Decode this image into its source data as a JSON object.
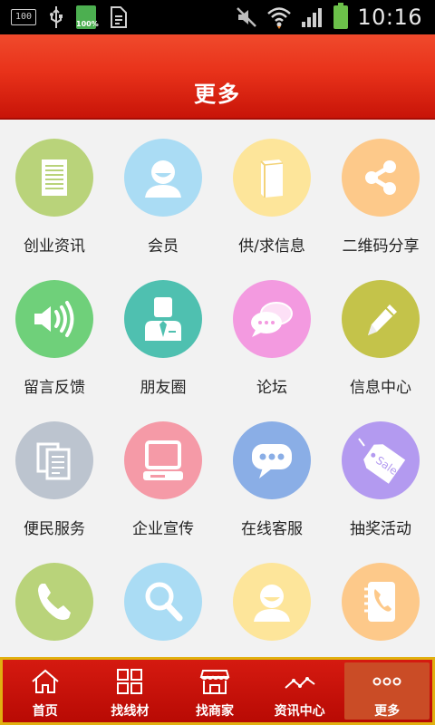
{
  "status_bar": {
    "left_box_text": "100",
    "battery_small_text": "100%",
    "time": "10:16",
    "icons": [
      "storage-icon",
      "usb-icon",
      "battery-full-icon",
      "sim-card-icon",
      "mute-icon",
      "wifi-icon",
      "signal-icon",
      "battery-icon"
    ]
  },
  "header": {
    "title": "更多"
  },
  "grid": {
    "items": [
      {
        "label": "创业资讯",
        "icon": "document-icon",
        "color": "#b9d37a"
      },
      {
        "label": "会员",
        "icon": "member-icon",
        "color": "#aadcf4"
      },
      {
        "label": "供/求信息",
        "icon": "book-icon",
        "color": "#fde59a"
      },
      {
        "label": "二维码分享",
        "icon": "share-icon",
        "color": "#fdc98a"
      },
      {
        "label": "留言反馈",
        "icon": "speaker-icon",
        "color": "#6fd07a"
      },
      {
        "label": "朋友圈",
        "icon": "businessman-icon",
        "color": "#4fc0b0"
      },
      {
        "label": "论坛",
        "icon": "chat-bubbles-icon",
        "color": "#f39ae0"
      },
      {
        "label": "信息中心",
        "icon": "pencil-icon",
        "color": "#c4c34a"
      },
      {
        "label": "便民服务",
        "icon": "files-icon",
        "color": "#bcc4cf"
      },
      {
        "label": "企业宣传",
        "icon": "computer-icon",
        "color": "#f59aa7"
      },
      {
        "label": "在线客服",
        "icon": "chat-dots-icon",
        "color": "#8aaee6"
      },
      {
        "label": "抽奖活动",
        "icon": "sale-tag-icon",
        "color": "#b39af0"
      },
      {
        "label": "",
        "icon": "phone-icon",
        "color": "#b9d37a"
      },
      {
        "label": "",
        "icon": "search-icon",
        "color": "#aadcf4"
      },
      {
        "label": "",
        "icon": "member-icon",
        "color": "#fde59a"
      },
      {
        "label": "",
        "icon": "address-book-icon",
        "color": "#fdc98a"
      }
    ]
  },
  "nav": {
    "items": [
      {
        "label": "首页",
        "icon": "home-icon"
      },
      {
        "label": "找线材",
        "icon": "grid-icon"
      },
      {
        "label": "找商家",
        "icon": "shop-icon"
      },
      {
        "label": "资讯中心",
        "icon": "trend-icon"
      },
      {
        "label": "更多",
        "icon": "more-icon",
        "active": true
      }
    ]
  }
}
